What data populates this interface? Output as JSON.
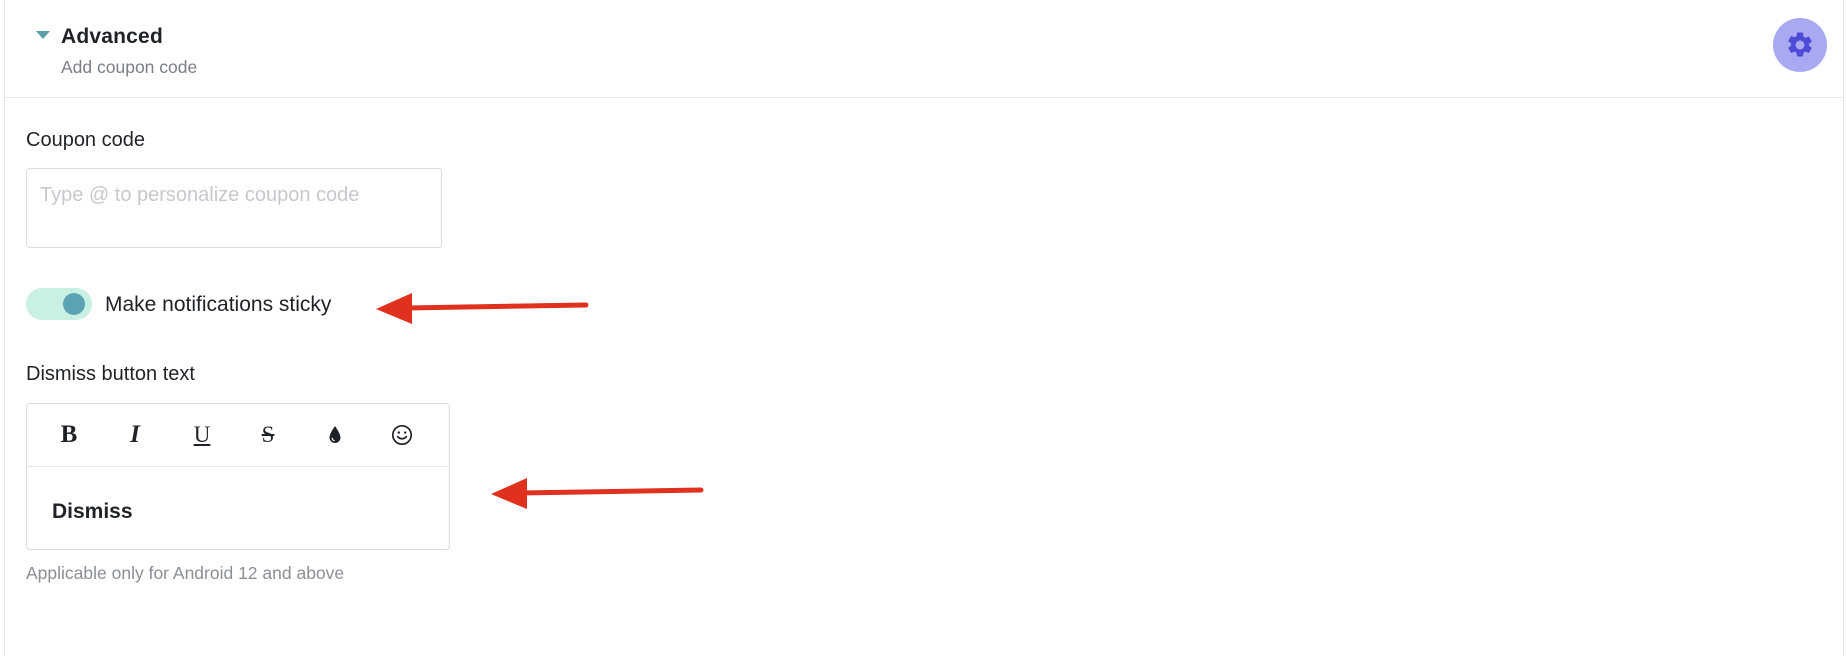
{
  "header": {
    "title": "Advanced",
    "subtitle": "Add coupon code",
    "caret_icon": "caret-down-icon",
    "settings_icon": "gear-icon"
  },
  "coupon": {
    "label": "Coupon code",
    "value": "",
    "placeholder": "Type @ to personalize coupon code"
  },
  "sticky": {
    "label": "Make notifications sticky",
    "enabled": true
  },
  "dismiss": {
    "label": "Dismiss button text",
    "toolbar": {
      "bold": "B",
      "italic": "I",
      "underline": "U",
      "strikethrough": "S",
      "color_icon": "drop-icon",
      "emoji_icon": "emoji-icon"
    },
    "value": "Dismiss",
    "help": "Applicable only for Android 12 and above"
  },
  "colors": {
    "accent": "#5aa4b6",
    "toggle_track": "#c8f0e3",
    "gear_bg": "#a9a9f3",
    "gear_fg": "#4b4bd6",
    "annotation_arrow": "#e0301e"
  }
}
